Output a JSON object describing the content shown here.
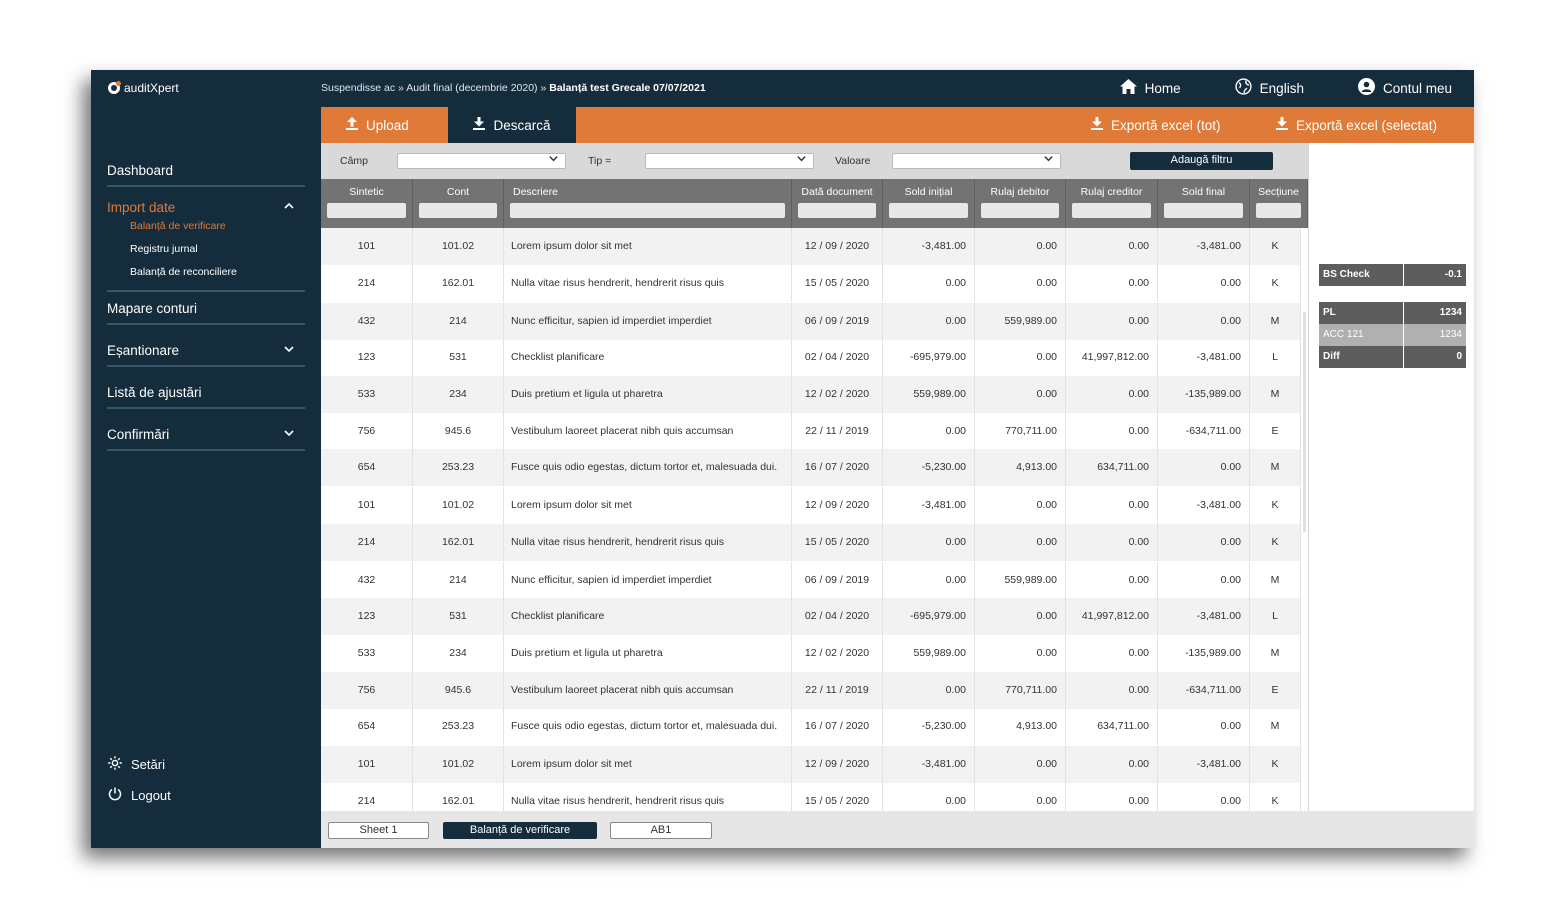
{
  "app": {
    "logo_text": "auditXpert"
  },
  "breadcrumb": {
    "path": "Suspendisse ac » Audit final (decembrie 2020) » ",
    "current": "Balanță test Grecale 07/07/2021"
  },
  "topnav": {
    "home": "Home",
    "language": "English",
    "account": "Contul meu"
  },
  "toolbar": {
    "upload": "Upload",
    "download": "Descarcă",
    "export_all": "Exportă excel (tot)",
    "export_selected": "Exportă excel (selectat)"
  },
  "sidebar": {
    "dashboard": "Dashboard",
    "import": "Import date",
    "import_sub": [
      "Balanță de verificare",
      "Registru jurnal",
      "Balanță de reconciliere"
    ],
    "mapping": "Mapare conturi",
    "sampling": "Eșantionare",
    "adjustments": "Listă de ajustări",
    "confirmations": "Confirmări",
    "settings": "Setări",
    "logout": "Logout"
  },
  "filters": {
    "field_label": "Câmp",
    "type_label": "Tip =",
    "value_label": "Valoare",
    "add_button": "Adaugă filtru"
  },
  "table": {
    "headers": [
      "Sintetic",
      "Cont",
      "Descriere",
      "Dată document",
      "Sold inițial",
      "Rulaj debitor",
      "Rulaj creditor",
      "Sold final",
      "Secțiune"
    ],
    "rows": [
      [
        "101",
        "101.02",
        "Lorem ipsum dolor sit met",
        "12 / 09 / 2020",
        "-3,481.00",
        "0.00",
        "0.00",
        "-3,481.00",
        "K"
      ],
      [
        "214",
        "162.01",
        "Nulla vitae risus hendrerit, hendrerit risus quis",
        "15 / 05 / 2020",
        "0.00",
        "0.00",
        "0.00",
        "0.00",
        "K"
      ],
      [
        "432",
        "214",
        "Nunc efficitur, sapien id imperdiet imperdiet",
        "06 / 09 / 2019",
        "0.00",
        "559,989.00",
        "0.00",
        "0.00",
        "M"
      ],
      [
        "123",
        "531",
        "Checklist planificare",
        "02 / 04 / 2020",
        "-695,979.00",
        "0.00",
        "41,997,812.00",
        "-3,481.00",
        "L"
      ],
      [
        "533",
        "234",
        "Duis pretium et ligula ut pharetra",
        "12 / 02 / 2020",
        "559,989.00",
        "0.00",
        "0.00",
        "-135,989.00",
        "M"
      ],
      [
        "756",
        "945.6",
        "Vestibulum laoreet placerat nibh quis accumsan",
        "22 / 11 / 2019",
        "0.00",
        "770,711.00",
        "0.00",
        "-634,711.00",
        "E"
      ],
      [
        "654",
        "253.23",
        "Fusce quis odio egestas, dictum tortor et, malesuada dui.",
        "16 / 07 / 2020",
        "-5,230.00",
        "4,913.00",
        "634,711.00",
        "0.00",
        "M"
      ],
      [
        "101",
        "101.02",
        "Lorem ipsum dolor sit met",
        "12 / 09 / 2020",
        "-3,481.00",
        "0.00",
        "0.00",
        "-3,481.00",
        "K"
      ],
      [
        "214",
        "162.01",
        "Nulla vitae risus hendrerit, hendrerit risus quis",
        "15 / 05 / 2020",
        "0.00",
        "0.00",
        "0.00",
        "0.00",
        "K"
      ],
      [
        "432",
        "214",
        "Nunc efficitur, sapien id imperdiet imperdiet",
        "06 / 09 / 2019",
        "0.00",
        "559,989.00",
        "0.00",
        "0.00",
        "M"
      ],
      [
        "123",
        "531",
        "Checklist planificare",
        "02 / 04 / 2020",
        "-695,979.00",
        "0.00",
        "41,997,812.00",
        "-3,481.00",
        "L"
      ],
      [
        "533",
        "234",
        "Duis pretium et ligula ut pharetra",
        "12 / 02 / 2020",
        "559,989.00",
        "0.00",
        "0.00",
        "-135,989.00",
        "M"
      ],
      [
        "756",
        "945.6",
        "Vestibulum laoreet placerat nibh quis accumsan",
        "22 / 11 / 2019",
        "0.00",
        "770,711.00",
        "0.00",
        "-634,711.00",
        "E"
      ],
      [
        "654",
        "253.23",
        "Fusce quis odio egestas, dictum tortor et, malesuada dui.",
        "16 / 07 / 2020",
        "-5,230.00",
        "4,913.00",
        "634,711.00",
        "0.00",
        "M"
      ],
      [
        "101",
        "101.02",
        "Lorem ipsum dolor sit met",
        "12 / 09 / 2020",
        "-3,481.00",
        "0.00",
        "0.00",
        "-3,481.00",
        "K"
      ],
      [
        "214",
        "162.01",
        "Nulla vitae risus hendrerit, hendrerit risus quis",
        "15 / 05 / 2020",
        "0.00",
        "0.00",
        "0.00",
        "0.00",
        "K"
      ]
    ]
  },
  "sheets": [
    "Sheet 1",
    "Balanță de verificare",
    "AB1"
  ],
  "checks": {
    "bs_check": {
      "label": "BS Check",
      "value": "-0.1"
    },
    "pl": {
      "label": "PL",
      "value": "1234"
    },
    "acc121": {
      "label": "ACC 121",
      "value": "1234"
    },
    "diff": {
      "label": "Diff",
      "value": "0"
    }
  },
  "colors": {
    "navy": "#142c3c",
    "orange": "#e07a38",
    "header_grey": "#737373"
  }
}
